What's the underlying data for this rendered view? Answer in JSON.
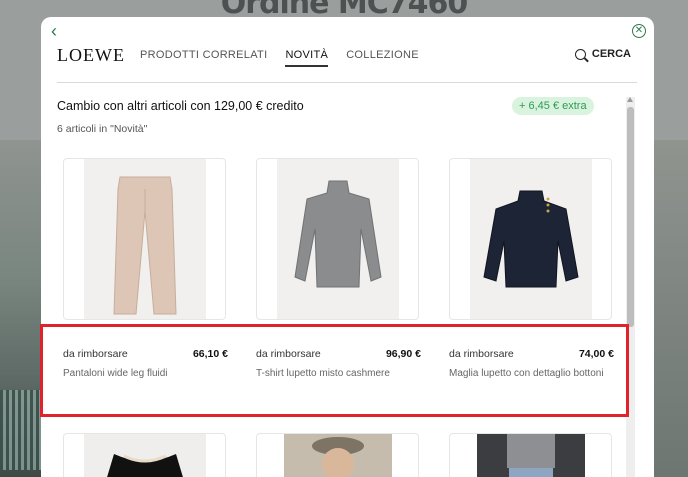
{
  "background": {
    "title": "Ordine MC7460"
  },
  "modal": {
    "brand": "LOEWE",
    "nav": [
      {
        "label": "PRODOTTI CORRELATI",
        "active": false
      },
      {
        "label": "NOVITÀ",
        "active": true
      },
      {
        "label": "COLLEZIONE",
        "active": false
      }
    ],
    "search_label": "CERCA",
    "heading": "Cambio con altri articoli con 129,00 € credito",
    "extra_badge": "+ 6,45 € extra",
    "count_text": "6 articoli in \"Novità\"",
    "products": [
      {
        "label": "da rimborsare",
        "price": "66,10 €",
        "name": "Pantaloni wide leg fluidi",
        "image": "beige-trousers"
      },
      {
        "label": "da rimborsare",
        "price": "96,90 €",
        "name": "T-shirt lupetto misto cashmere",
        "image": "grey-turtleneck"
      },
      {
        "label": "da rimborsare",
        "price": "74,00 €",
        "name": "Maglia lupetto con dettaglio bottoni",
        "image": "navy-knit-sweater"
      }
    ],
    "row2_images": [
      "black-top-with-trim",
      "person-in-cap",
      "denim-outfit"
    ]
  },
  "colors": {
    "accent_green": "#2d7a4b",
    "badge_bg": "#d9f3df",
    "badge_text": "#2e9a55",
    "highlight_red": "#e0222a"
  }
}
